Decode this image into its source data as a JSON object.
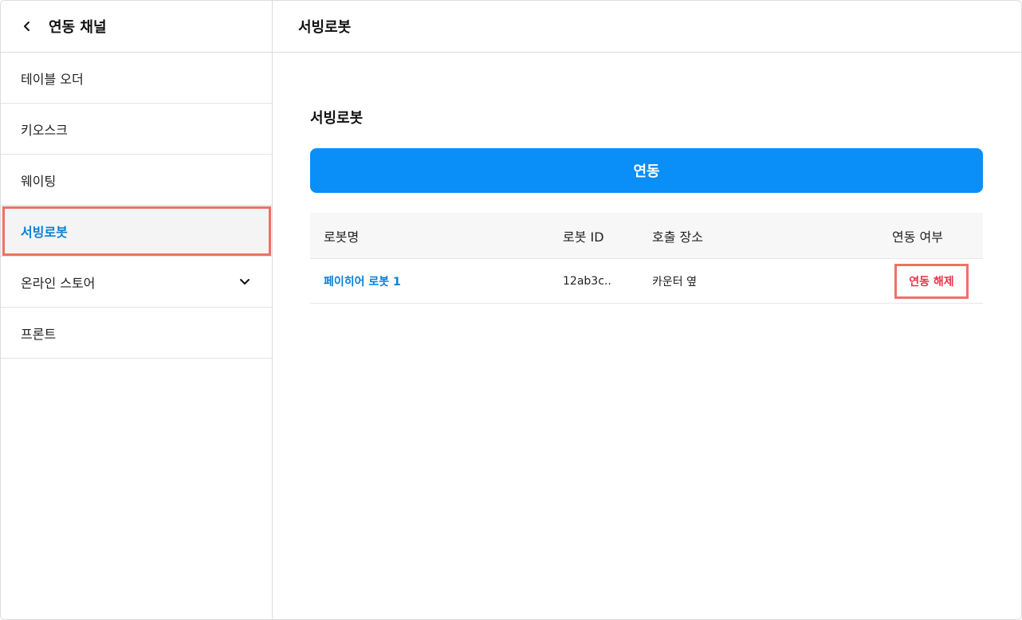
{
  "sidebar": {
    "title": "연동 채널",
    "items": [
      {
        "label": "테이블 오더"
      },
      {
        "label": "키오스크"
      },
      {
        "label": "웨이팅"
      },
      {
        "label": "서빙로봇"
      },
      {
        "label": "온라인 스토어"
      },
      {
        "label": "프론트"
      }
    ],
    "active_index": 3
  },
  "main": {
    "header_title": "서빙로봇",
    "section_title": "서빙로봇",
    "link_button_label": "연동",
    "table": {
      "headers": [
        "로봇명",
        "로봇 ID",
        "호출 장소",
        "연동 여부"
      ],
      "rows": [
        {
          "name": "페이히어 로봇 1",
          "id": "12ab3c..",
          "location": "카운터 옆",
          "action": "연동 해제"
        }
      ]
    }
  },
  "colors": {
    "accent": "#0a8ef8",
    "active_text": "#0a7fd4",
    "highlight_border": "#ee7263",
    "danger_text": "#e5364a"
  },
  "icons": {
    "back": "chevron-left-icon",
    "expand": "chevron-down-icon"
  }
}
